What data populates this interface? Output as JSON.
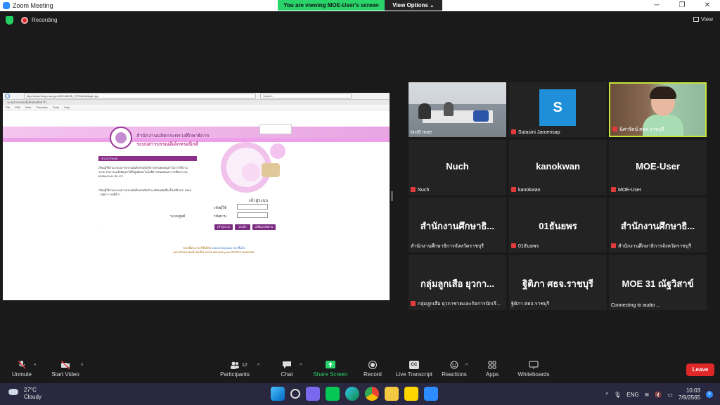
{
  "window": {
    "title": "Zoom Meeting"
  },
  "banner": {
    "viewing": "You are viewing MOE-User's screen",
    "view_options": "View Options ⌄"
  },
  "topbar": {
    "recording": "Recording",
    "view": "View"
  },
  "shared_screen": {
    "browser_url": "http://www.thing.moe.go.th/EXAMOE_OPS/ebhe/login.jsp",
    "browser_search": "Search...",
    "browser_tab": "ระบบสารบรรณอิเล็กทรอนิกส์ สำ...",
    "browser_menu": [
      "File",
      "Edit",
      "View",
      "Favorites",
      "Tools",
      "Help"
    ],
    "site_title": "สำนักงานปลัดกระทรวงศึกษาธิการ",
    "site_subtitle": "ระบบสารบรรณอิเล็กทรอนิกส์",
    "news_header": "ข่าวสารระบบ",
    "news_text_1": "เรียนผู้ใช้งานระบบสารบรรณอิเล็กทรอนิกส์หากท่านพบปัญหาในการใช้งานระบบ สามารถแจ้งปัญหาได้ที่ ศูนย์เทคโนโลยีสารสนเทศและการสื่อสาร 02-6285643-44 ต่อ 471",
    "news_text_2": "เรียนผู้ใช้งานระบบสารบรรณอิเล็กทรอนิกส์ ทะเบียนหนังสือ ตั้งแต่ปี พ.ศ. 2548 - 2560 ** กดที่นี่ **",
    "login_title": "เข้าสู่ระบบ",
    "login_user_label": "รหัสผู้ใช้",
    "login_pass_label": "รหัสผ่าน",
    "year_label": "ระบบศูนย์",
    "btn_login": "เข้าสู่ระบบ",
    "btn_cancel": "ยกเลิก",
    "btn_change_pw": "เปลี่ยนรหัสผ่าน",
    "footer_note_1": "ระบบนี้สามารถใช้ได้กับ",
    "footer_note_browser": "Internet Explorer 5.5 ขึ้นไป",
    "footer_note_2": "และปรับขนาดหน้าจอเป็น ขนาด 800x600 pixel สำหรับการแสดงผล"
  },
  "participants_tiles": [
    {
      "display": "",
      "name": "bict6 moe",
      "type": "video-office",
      "muted": false
    },
    {
      "display": "S",
      "name": "Sutasini Jaroensap",
      "type": "avatar",
      "muted": true
    },
    {
      "display": "",
      "name": "นิศารัตน์ ศธจ.ราชบุรี",
      "type": "video-person",
      "muted": true,
      "active": true
    },
    {
      "display": "Nuch",
      "name": "Nuch",
      "type": "text",
      "muted": true
    },
    {
      "display": "kanokwan",
      "name": "kanokwan",
      "type": "text",
      "muted": true
    },
    {
      "display": "MOE-User",
      "name": "MOE-User",
      "type": "text",
      "muted": true
    },
    {
      "display": "สำนักงานศึกษาธิ...",
      "name": "สำนักงานศึกษาธิการจังหวัดราชบุรี",
      "type": "text",
      "muted": false
    },
    {
      "display": "01ธันยพร",
      "name": "01ธันยพร",
      "type": "text",
      "muted": true
    },
    {
      "display": "สำนักงานศึกษาธิ...",
      "name": "สำนักงานศึกษาธิการจังหวัดราชบุรี",
      "type": "text",
      "muted": true
    },
    {
      "display": "กลุ่มลูกเสือ ยุวกา...",
      "name": "กลุ่มลูกเสือ ยุวกาชาดและกิจการนักเรี...",
      "type": "text",
      "muted": true
    },
    {
      "display": "ฐิติภา ศธจ.ราชบุรี",
      "name": "ฐิติภา ศธจ.ราชบุรี",
      "type": "text",
      "muted": false
    },
    {
      "display": "MOE 31 ณัฐวิสาข์",
      "name": "Connecting to audio ...",
      "type": "text",
      "muted": false
    }
  ],
  "toolbar": {
    "unmute": "Unmute",
    "start_video": "Start Video",
    "participants": "Participants",
    "participants_count": "12",
    "chat": "Chat",
    "share_screen": "Share Screen",
    "record": "Record",
    "live_transcript": "Live Transcript",
    "reactions": "Reactions",
    "apps": "Apps",
    "whiteboards": "Whiteboards",
    "leave": "Leave",
    "cc": "CC"
  },
  "taskbar": {
    "temperature": "27°C",
    "weather": "Cloudy",
    "lang": "ENG",
    "time": "10:03",
    "date": "7/9/2565",
    "notif": "5"
  },
  "colors": {
    "share_green": "#2bd36b",
    "leave_red": "#e02828",
    "active_border": "#c6e33a",
    "zoom_blue": "#2d8cff"
  }
}
